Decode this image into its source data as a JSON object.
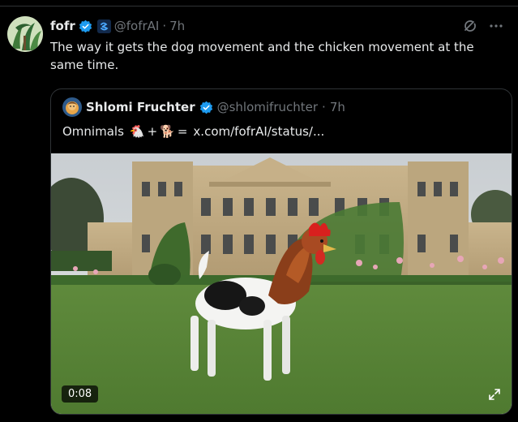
{
  "tweet": {
    "author_name": "fofr",
    "handle": "@fofrAI",
    "separator": "·",
    "time": "7h",
    "text": "The way it gets the dog movement and the chicken movement at the same time."
  },
  "quote": {
    "author_name": "Shlomi Fruchter",
    "handle": "@shlomifruchter",
    "separator": "·",
    "time": "7h",
    "text_prefix": "Omnimals",
    "emoji_chicken": "🐔",
    "plus": "+",
    "emoji_dog": "🐕",
    "equals": "=",
    "link": "x.com/fofrAI/status/..."
  },
  "video": {
    "duration": "0:08"
  },
  "colors": {
    "background": "#000000",
    "text": "#e7e9ea",
    "secondary": "#71767b",
    "verified": "#1d9bf0",
    "border": "#2f3336"
  },
  "icons": [
    "verified-icon",
    "affiliate-badge-icon",
    "grok-icon",
    "more-icon",
    "expand-icon"
  ]
}
